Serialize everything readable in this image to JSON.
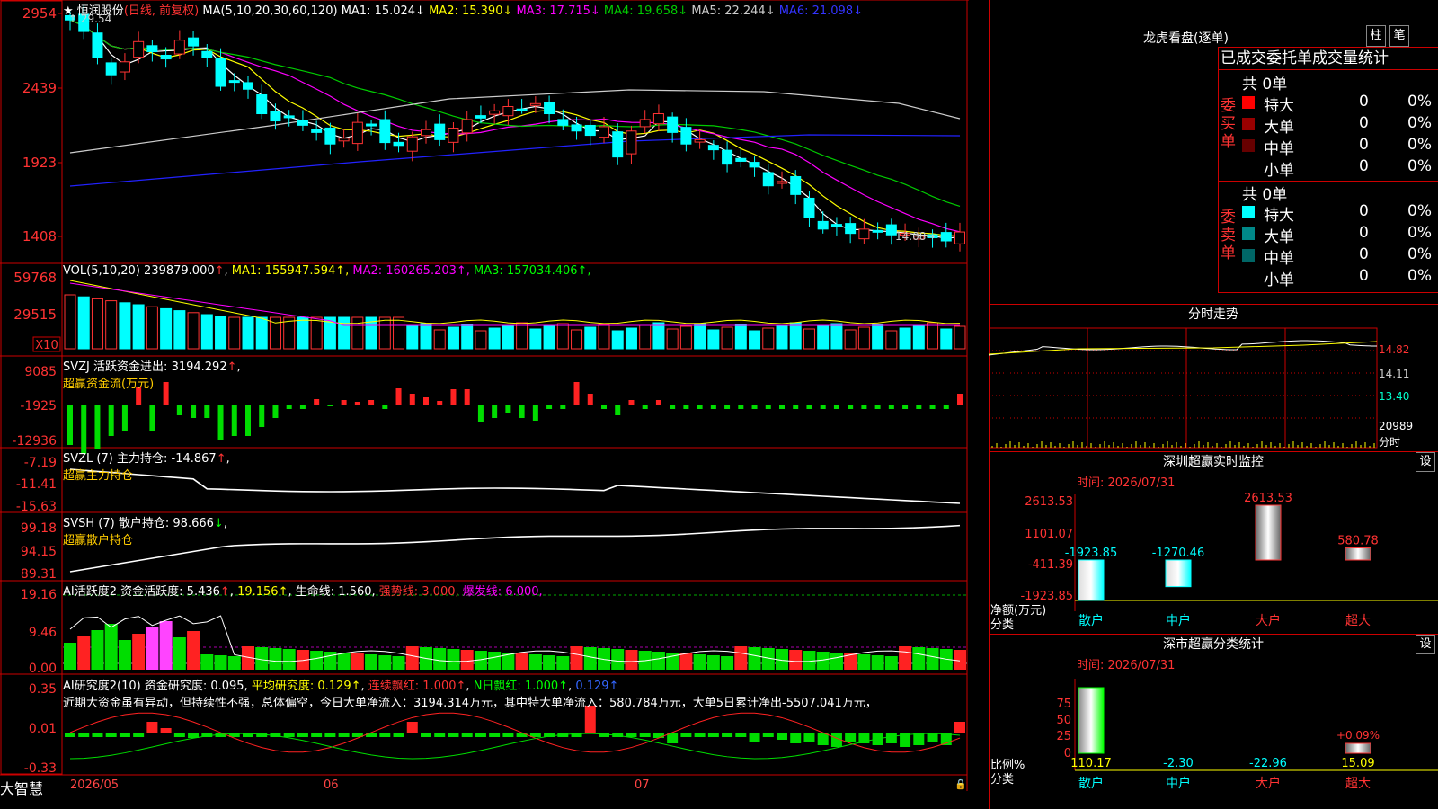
{
  "stock": {
    "name": "恒润股份",
    "mode": "(日线, 前复权)",
    "ma_label": "MA(5,10,20,30,60,120)",
    "ma_values": [
      {
        "name": "MA1",
        "value": "15.024",
        "color": "#ffffff"
      },
      {
        "name": "MA2",
        "value": "15.390",
        "color": "#ffff00"
      },
      {
        "name": "MA3",
        "value": "17.715",
        "color": "#ff00ff"
      },
      {
        "name": "MA4",
        "value": "19.658",
        "color": "#00cc00"
      },
      {
        "name": "MA5",
        "value": "22.244",
        "color": "#cccccc"
      },
      {
        "name": "MA6",
        "value": "21.098",
        "color": "#3333ff"
      }
    ],
    "high_label": "29.54",
    "low_label": "14.08",
    "price_axis": [
      "2954",
      "2439",
      "1923",
      "1408"
    ]
  },
  "volume": {
    "label": "VOL(5,10,20)",
    "value": "239879.000",
    "ma": [
      {
        "name": "MA1",
        "value": "155947.594",
        "color": "#ffff00"
      },
      {
        "name": "MA2",
        "value": "160265.203",
        "color": "#ff00ff"
      },
      {
        "name": "MA3",
        "value": "157034.406",
        "color": "#00ff00"
      }
    ],
    "axis": [
      "59768",
      "29515"
    ],
    "unit": "X10"
  },
  "svzj": {
    "label": "SVZJ",
    "title": "活跃资金进出:",
    "value": "3194.292",
    "sub": "超赢资金流(万元)",
    "axis": [
      "9085",
      "-1925",
      "-12936"
    ]
  },
  "svzl": {
    "label": "SVZL (7)",
    "title": "主力持仓:",
    "value": "-14.867",
    "sub": "超赢主力持仓",
    "axis": [
      "-7.19",
      "-11.41",
      "-15.63"
    ]
  },
  "svsh": {
    "label": "SVSH (7)",
    "title": "散户持仓:",
    "value": "98.666",
    "sub": "超赢散户持仓",
    "axis": [
      "99.18",
      "94.15",
      "89.31"
    ]
  },
  "ai_active": {
    "label": "AI活跃度2",
    "t1": "资金活跃度:",
    "v1": "5.436",
    "v2": "19.156",
    "t3": "生命线:",
    "v3": "1.560",
    "t4": "强势线:",
    "v4": "3.000",
    "t5": "爆发线:",
    "v5": "6.000",
    "axis": [
      "19.16",
      "9.46",
      "0.00"
    ]
  },
  "ai_research": {
    "label": "AI研究度2(10)",
    "t1": "资金研究度:",
    "v1": "0.095",
    "t2": "平均研究度:",
    "v2": "0.129",
    "t3": "连续飘红:",
    "v3": "1.000",
    "t4": "N日飘红:",
    "v4": "1.000",
    "v5": "0.129",
    "comment": "近期大资金虽有异动，但持续性不强，总体偏空，今日大单净流入：3194.314万元，其中特大单净流入：580.784万元，大单5日累计净出-5507.041万元，",
    "axis": [
      "0.35",
      "0.01",
      "-0.33"
    ]
  },
  "dates": {
    "d1": "2026/05",
    "d2": "06",
    "d3": "07"
  },
  "brand": "大智慧",
  "dragon": {
    "title": "龙虎看盘(逐单)",
    "btn1": "柱",
    "btn2": "笔",
    "subtitle": "已成交委托单成交量统计",
    "buy_label": "委买单",
    "sell_label": "委卖单",
    "buy_total": "共 0单",
    "sell_total": "共 0单",
    "buy_rows": [
      {
        "name": "特大",
        "qty": "0",
        "pct": "0%",
        "color": "#ff0000"
      },
      {
        "name": "大单",
        "qty": "0",
        "pct": "0%",
        "color": "#990000"
      },
      {
        "name": "中单",
        "qty": "0",
        "pct": "0%",
        "color": "#660000"
      },
      {
        "name": "小单",
        "qty": "0",
        "pct": "0%",
        "color": "#000000"
      }
    ],
    "sell_rows": [
      {
        "name": "特大",
        "qty": "0",
        "pct": "0%",
        "color": "#00ffff"
      },
      {
        "name": "大单",
        "qty": "0",
        "pct": "0%",
        "color": "#008888"
      },
      {
        "name": "中单",
        "qty": "0",
        "pct": "0%",
        "color": "#006666"
      },
      {
        "name": "小单",
        "qty": "0",
        "pct": "0%",
        "color": "#000000"
      }
    ]
  },
  "intraday": {
    "title": "分时走势",
    "prices": [
      "14.82",
      "14.11",
      "13.40"
    ],
    "vol": "20989",
    "unit": "分时"
  },
  "sz_monitor": {
    "title": "深圳超赢实时监控",
    "settings": "设",
    "time": "时间: 2026/07/31",
    "axis": [
      "2613.53",
      "1101.07",
      "-411.39",
      "-1923.85"
    ],
    "ylabel": "净额(万元)",
    "xlabel": "分类",
    "bars": [
      {
        "cat": "散户",
        "value": "-1923.85"
      },
      {
        "cat": "中户",
        "value": "-1270.46"
      },
      {
        "cat": "大户",
        "value": "2613.53"
      },
      {
        "cat": "超大",
        "value": "580.78"
      }
    ]
  },
  "sz_stats": {
    "title": "深市超赢分类统计",
    "settings": "设",
    "time": "时间: 2026/07/31",
    "axis": [
      "75",
      "50",
      "25",
      "0"
    ],
    "ylabel": "比例%",
    "xlabel": "分类",
    "bars": [
      {
        "cat": "散户",
        "value": "110.17",
        "label": ""
      },
      {
        "cat": "中户",
        "value": "-2.30",
        "label": ""
      },
      {
        "cat": "大户",
        "value": "-22.96",
        "label": ""
      },
      {
        "cat": "超大",
        "value": "15.09",
        "label": "+0.09%"
      }
    ]
  },
  "chart_data": [
    {
      "type": "candlestick",
      "title": "恒润股份",
      "y_range": [
        14.08,
        29.54
      ],
      "x_ticks": [
        "2026/05",
        "06",
        "07"
      ],
      "close_approx": [
        29.4,
        28.6,
        26.8,
        25.6,
        26.5,
        27.9,
        27.2,
        26.7,
        28.0,
        27.6,
        26.8,
        24.8,
        25.1,
        24.6,
        22.9,
        22.4,
        22.7,
        22.1,
        21.6,
        20.8,
        21.2,
        22.3,
        22.1,
        20.9,
        20.7,
        21.3,
        21.8,
        21.1,
        21.9,
        22.5,
        22.6,
        23.1,
        23.4,
        23.2,
        23.6,
        22.9,
        22.1,
        21.7,
        21.4,
        22.0,
        19.9,
        21.7,
        22.5,
        22.9,
        21.6,
        20.8,
        21.1,
        20.4,
        19.4,
        19.6,
        19.2,
        17.9,
        18.2,
        17.3,
        15.7,
        14.9,
        15.1,
        14.6,
        14.9,
        14.8,
        14.5,
        14.6,
        14.4,
        14.3,
        14.08,
        14.7
      ]
    },
    {
      "type": "bar",
      "title": "超赢资金流(万元)",
      "y_range": [
        -12936,
        9085
      ]
    }
  ]
}
